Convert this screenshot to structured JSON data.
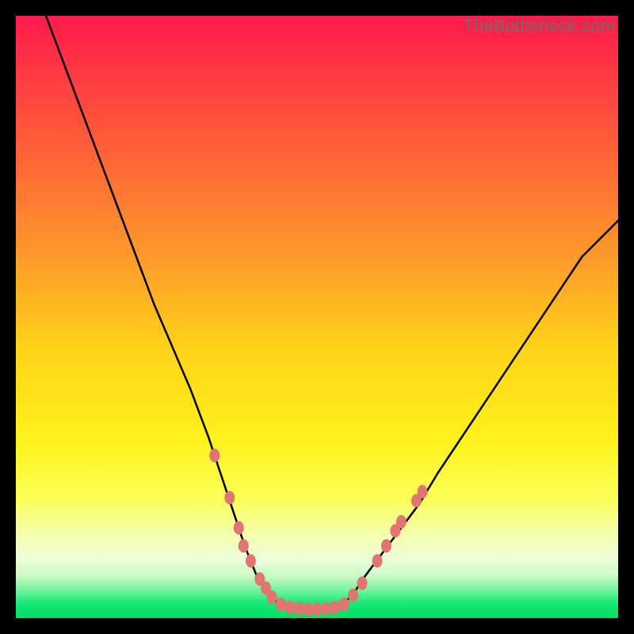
{
  "watermark": "TheBottleneck.com",
  "chart_data": {
    "type": "line",
    "title": "",
    "xlabel": "",
    "ylabel": "",
    "xlim": [
      0,
      100
    ],
    "ylim": [
      0,
      100
    ],
    "grid": false,
    "legend": false,
    "background_gradient": {
      "stops": [
        {
          "offset": 0.0,
          "color": "#ff1b4b"
        },
        {
          "offset": 0.2,
          "color": "#ff5a3a"
        },
        {
          "offset": 0.4,
          "color": "#ff9a2a"
        },
        {
          "offset": 0.55,
          "color": "#ffd21a"
        },
        {
          "offset": 0.7,
          "color": "#fff11a"
        },
        {
          "offset": 0.8,
          "color": "#fbff56"
        },
        {
          "offset": 0.86,
          "color": "#f6ffad"
        },
        {
          "offset": 0.9,
          "color": "#eefed9"
        },
        {
          "offset": 0.93,
          "color": "#c9fbc4"
        },
        {
          "offset": 0.955,
          "color": "#6ef39a"
        },
        {
          "offset": 0.975,
          "color": "#18e876"
        },
        {
          "offset": 1.0,
          "color": "#00df66"
        }
      ]
    },
    "series": [
      {
        "name": "bottleneck-curve-left",
        "stroke": "#000000",
        "x": [
          5,
          8,
          11,
          14,
          17,
          20,
          23,
          26,
          29,
          32,
          34,
          36,
          38,
          40,
          42,
          44
        ],
        "y": [
          100,
          92,
          84,
          76,
          68,
          60,
          52,
          45,
          38,
          30,
          24,
          18,
          12,
          7,
          4,
          2
        ]
      },
      {
        "name": "bottleneck-curve-flat",
        "stroke": "#000000",
        "x": [
          44,
          46,
          48,
          50,
          52,
          54
        ],
        "y": [
          2,
          1.5,
          1.5,
          1.5,
          1.5,
          2
        ]
      },
      {
        "name": "bottleneck-curve-right",
        "stroke": "#000000",
        "x": [
          54,
          56,
          58,
          61,
          64,
          67,
          70,
          74,
          78,
          82,
          86,
          90,
          94,
          98,
          100
        ],
        "y": [
          2,
          4,
          7,
          11,
          15,
          19,
          24,
          30,
          36,
          42,
          48,
          54,
          60,
          64,
          66
        ]
      }
    ],
    "scatter": {
      "name": "gpu-points",
      "color": "#e0766f",
      "points": [
        {
          "x": 33.0,
          "y": 27.0
        },
        {
          "x": 35.5,
          "y": 20.0
        },
        {
          "x": 37.0,
          "y": 15.0
        },
        {
          "x": 37.8,
          "y": 12.0
        },
        {
          "x": 39.0,
          "y": 9.5
        },
        {
          "x": 40.5,
          "y": 6.5
        },
        {
          "x": 41.5,
          "y": 5.0
        },
        {
          "x": 42.5,
          "y": 3.5
        },
        {
          "x": 44.0,
          "y": 2.3
        },
        {
          "x": 45.5,
          "y": 1.8
        },
        {
          "x": 47.0,
          "y": 1.6
        },
        {
          "x": 48.5,
          "y": 1.5
        },
        {
          "x": 50.0,
          "y": 1.5
        },
        {
          "x": 51.5,
          "y": 1.6
        },
        {
          "x": 53.0,
          "y": 1.8
        },
        {
          "x": 54.5,
          "y": 2.3
        },
        {
          "x": 56.0,
          "y": 3.8
        },
        {
          "x": 57.5,
          "y": 5.8
        },
        {
          "x": 60.0,
          "y": 9.5
        },
        {
          "x": 61.5,
          "y": 12.0
        },
        {
          "x": 63.0,
          "y": 14.5
        },
        {
          "x": 64.0,
          "y": 16.0
        },
        {
          "x": 66.5,
          "y": 19.5
        },
        {
          "x": 67.5,
          "y": 21.0
        }
      ]
    }
  }
}
